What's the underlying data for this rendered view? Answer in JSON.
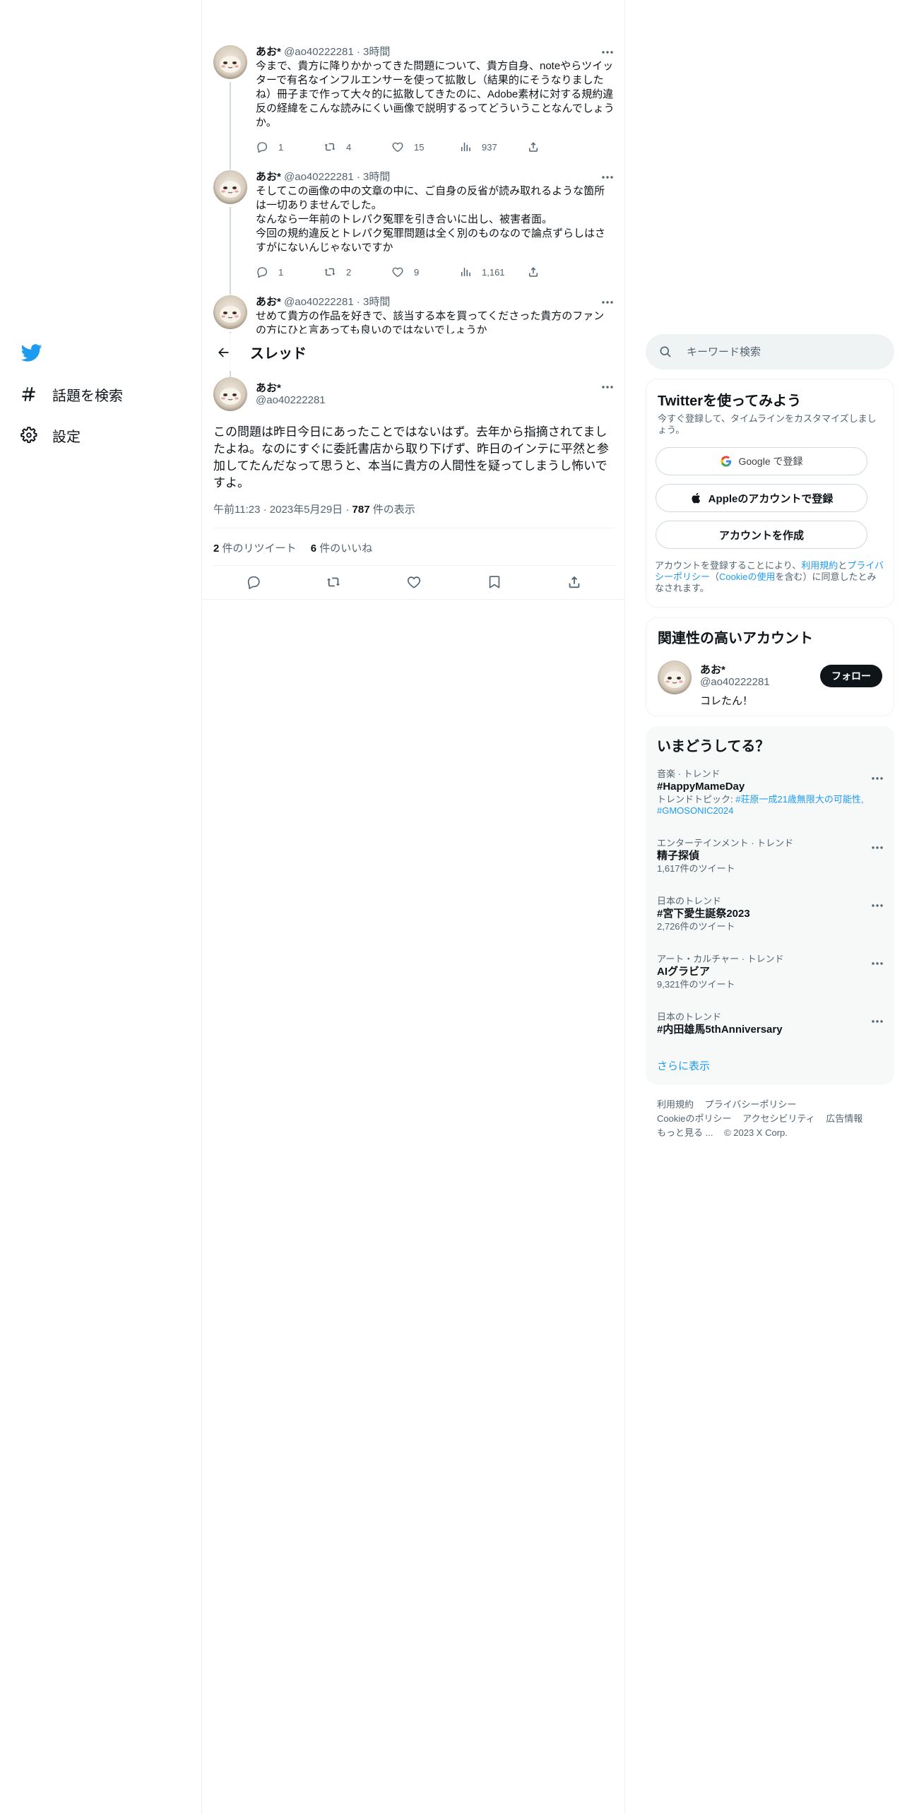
{
  "nav": {
    "explore_label": "話題を検索",
    "settings_label": "設定"
  },
  "colors": {
    "accent": "#1d9bf0",
    "text_primary": "#0f1419",
    "text_secondary": "#536471",
    "border": "#eff3f4",
    "trends_bg": "#f7f9f9"
  },
  "thread_header": {
    "title": "スレッド"
  },
  "replies": [
    {
      "name": "あお*",
      "handle_time": "@ao40222281 · 3時間",
      "text": "今まで、貴方に降りかかってきた問題について、貴方自身、noteやらツイッターで有名なインフルエンサーを使って拡散し（結果的にそうなりましたね）冊子まで作って大々的に拡散してきたのに、Adobe素材に対する規約違反の経緯をこんな読みにくい画像で説明するってどういうことなんでしょうか。",
      "replies_count": "1",
      "retweets": "4",
      "likes": "15",
      "views": "937"
    },
    {
      "name": "あお*",
      "handle_time": "@ao40222281 · 3時間",
      "text": "そしてこの画像の中の文章の中に、ご自身の反省が読み取れるような箇所は一切ありませんでした。\nなんなら一年前のトレパク冤罪を引き合いに出し、被害者面。\n今回の規約違反とトレパク冤罪問題は全く別のものなので論点ずらしはさすがにないんじゃないですか",
      "replies_count": "1",
      "retweets": "2",
      "likes": "9",
      "views": "1,161"
    },
    {
      "name": "あお*",
      "handle_time": "@ao40222281 · 3時間",
      "text": "せめて貴方の作品を好きで、該当する本を買ってくださった貴方のファンの方にひと言あっても良いのではないでしょうか"
    }
  ],
  "focal": {
    "name": "あお*",
    "handle": "@ao40222281",
    "text": "この問題は昨日今日にあったことではないはず。去年から指摘されてましたよね。なのにすぐに委託書店から取り下げず、昨日のインテに平然と参加してたんだなって思うと、本当に貴方の人間性を疑ってしまうし怖いですよ。",
    "time": "午前11:23",
    "date": "2023年5月29日",
    "views_count": "787",
    "views_label": "件の表示",
    "retweets_count": "2",
    "retweets_label": "件のリツイート",
    "likes_count": "6",
    "likes_label": "件のいいね"
  },
  "search": {
    "placeholder": "キーワード検索"
  },
  "signup": {
    "title": "Twitterを使ってみよう",
    "subtitle": "今すぐ登録して、タイムラインをカスタマイズしましょう。",
    "google_label": "Google で登録",
    "apple_label": "Appleのアカウントで登録",
    "create_label": "アカウントを作成",
    "legal_prefix": "アカウントを登録することにより、",
    "legal_terms": "利用規約",
    "legal_and": "と",
    "legal_privacy": "プライバシーポリシー",
    "legal_paren_open": "（",
    "legal_cookie": "Cookieの使用",
    "legal_suffix": "を含む）に同意したとみなされます。"
  },
  "related": {
    "title": "関連性の高いアカウント",
    "name": "あお*",
    "handle": "@ao40222281",
    "bio": "コレたん！",
    "follow_label": "フォロー"
  },
  "trends": {
    "title": "いまどうしてる？",
    "items": [
      {
        "context": "音楽 · トレンド",
        "name": "#HappyMameDay",
        "topic_prefix": "トレンドトピック: ",
        "topic": "#荘原一成21歳無限大の可能性, #GMOSONIC2024"
      },
      {
        "context": "エンターテインメント · トレンド",
        "name": "精子探偵",
        "count": "1,617件のツイート"
      },
      {
        "context": "日本のトレンド",
        "name": "#宮下愛生誕祭2023",
        "count": "2,726件のツイート"
      },
      {
        "context": "アート・カルチャー · トレンド",
        "name": "AIグラビア",
        "count": "9,321件のツイート"
      },
      {
        "context": "日本のトレンド",
        "name": "#内田雄馬5thAnniversary"
      }
    ],
    "show_more": "さらに表示"
  },
  "footer": {
    "terms": "利用規約",
    "privacy": "プライバシーポリシー",
    "cookie": "Cookieのポリシー",
    "accessibility": "アクセシビリティ",
    "ads": "広告情報",
    "more": "もっと見る ...",
    "copyright": "© 2023 X Corp."
  }
}
